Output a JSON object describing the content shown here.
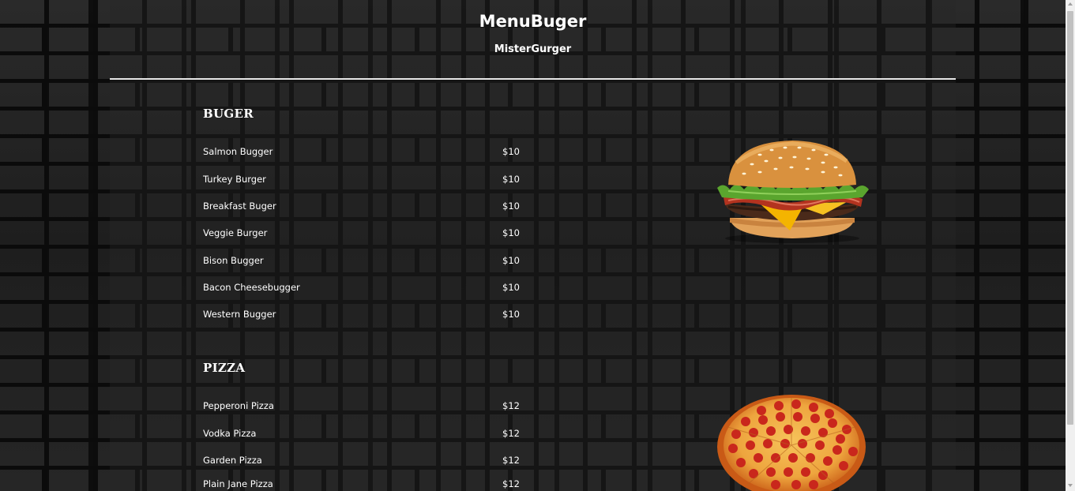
{
  "header": {
    "title": "MenuBuger",
    "subtitle": "MisterGurger"
  },
  "sections": [
    {
      "heading": "BUGER",
      "image_icon": "burger-image",
      "items": [
        {
          "name": "Salmon Bugger",
          "price": "$10"
        },
        {
          "name": "Turkey Burger",
          "price": "$10"
        },
        {
          "name": "Breakfast Buger",
          "price": "$10"
        },
        {
          "name": "Veggie Burger",
          "price": "$10"
        },
        {
          "name": "Bison Bugger",
          "price": "$10"
        },
        {
          "name": "Bacon Cheesebugger",
          "price": "$10"
        },
        {
          "name": "Western Bugger",
          "price": "$10"
        }
      ]
    },
    {
      "heading": "PIZZA",
      "image_icon": "pizza-image",
      "items": [
        {
          "name": "Pepperoni Pizza",
          "price": "$12"
        },
        {
          "name": "Vodka Pizza",
          "price": "$12"
        },
        {
          "name": "Garden Pizza",
          "price": "$12"
        },
        {
          "name": "Plain Jane Pizza",
          "price": "$12"
        }
      ]
    }
  ],
  "colors": {
    "text": "#ffffff",
    "background": "#1b1b1b",
    "divider": "#e6e6e6"
  }
}
